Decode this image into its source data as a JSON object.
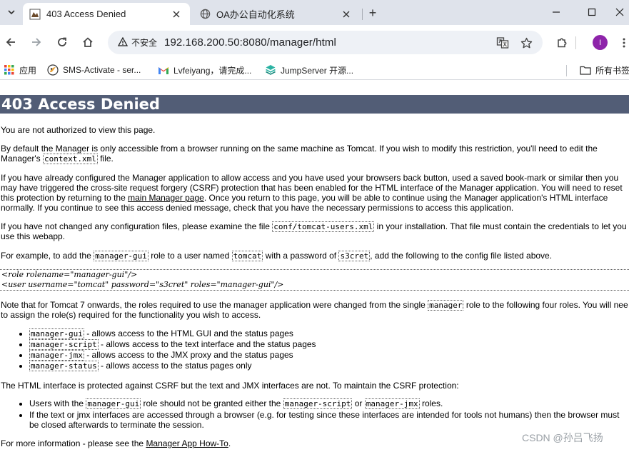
{
  "browser": {
    "tabs": [
      {
        "title": "403 Access Denied",
        "favicon": "tomcat-page-icon",
        "active": true
      },
      {
        "title": "OA办公自动化系统",
        "favicon": "globe-icon",
        "active": false
      }
    ],
    "new_tab_label": "+",
    "address": {
      "security_label": "不安全",
      "url": "192.168.200.50:8080/manager/html"
    },
    "profile_initial": "I",
    "bookmarks": [
      {
        "label": "应用",
        "icon": "apps-grid-icon"
      },
      {
        "label": "SMS-Activate - ser...",
        "icon": "sms-activate-icon"
      },
      {
        "label": "Lvfeiyang，请完成...",
        "icon": "gmail-icon"
      },
      {
        "label": "JumpServer 开源...",
        "icon": "jumpserver-icon"
      }
    ],
    "all_bookmarks_label": "所有书签"
  },
  "page": {
    "heading": "403 Access Denied",
    "p1": "You are not authorized to view this page.",
    "p2_line1": "By default the Manager is only accessible from a browser running on the same machine as Tomcat. If you wish to modify this restriction, you'll need to edit the",
    "p2_line2_a": "Manager's ",
    "p2_code": "context.xml",
    "p2_line2_b": " file.",
    "p3_line1": "If you have already configured the Manager application to allow access and you have used your browsers back button, used a saved book-mark or similar then you",
    "p3_line2": "may have triggered the cross-site request forgery (CSRF) protection that has been enabled for the HTML interface of the Manager application. You will need to reset",
    "p3_line3_a": "this protection by returning to the ",
    "p3_link": "main Manager page",
    "p3_line3_b": ". Once you return to this page, you will be able to continue using the Manager application's HTML interface",
    "p3_line4": "normally. If you continue to see this access denied message, check that you have the necessary permissions to access this application.",
    "p4_line1_a": "If you have not changed any configuration files, please examine the file ",
    "p4_code": "conf/tomcat-users.xml",
    "p4_line1_b": " in your installation. That file must contain the credentials to let you",
    "p4_line2": "use this webapp.",
    "p5_a": "For example, to add the ",
    "p5_code1": "manager-gui",
    "p5_b": " role to a user named ",
    "p5_code2": "tomcat",
    "p5_c": " with a password of ",
    "p5_code3": "s3cret",
    "p5_d": ", add the following to the config file listed above.",
    "pre_line1": "<role rolename=\"manager-gui\"/>",
    "pre_line2": "<user username=\"tomcat\" password=\"s3cret\" roles=\"manager-gui\"/>",
    "p6_line1_a": "Note that for Tomcat 7 onwards, the roles required to use the manager application were changed from the single ",
    "p6_code": "manager",
    "p6_line1_b": " role to the following four roles. You will nee",
    "p6_line2": "to assign the role(s) required for the functionality you wish to access.",
    "roles": [
      {
        "code": "manager-gui",
        "desc": " - allows access to the HTML GUI and the status pages"
      },
      {
        "code": "manager-script",
        "desc": " - allows access to the text interface and the status pages"
      },
      {
        "code": "manager-jmx",
        "desc": " - allows access to the JMX proxy and the status pages"
      },
      {
        "code": "manager-status",
        "desc": " - allows access to the status pages only"
      }
    ],
    "p7": "The HTML interface is protected against CSRF but the text and JMX interfaces are not. To maintain the CSRF protection:",
    "csrf1_a": "Users with the ",
    "csrf1_code1": "manager-gui",
    "csrf1_b": " role should not be granted either the ",
    "csrf1_code2": "manager-script",
    "csrf1_c": " or ",
    "csrf1_code3": "manager-jmx",
    "csrf1_d": " roles.",
    "csrf2_line1": "If the text or jmx interfaces are accessed through a browser (e.g. for testing since these interfaces are intended for tools not humans) then the browser must",
    "csrf2_line2": "be closed afterwards to terminate the session.",
    "p8_a": "For more information - please see the ",
    "p8_link": "Manager App How-To",
    "p8_b": "."
  },
  "watermark": "CSDN @孙吕飞扬"
}
